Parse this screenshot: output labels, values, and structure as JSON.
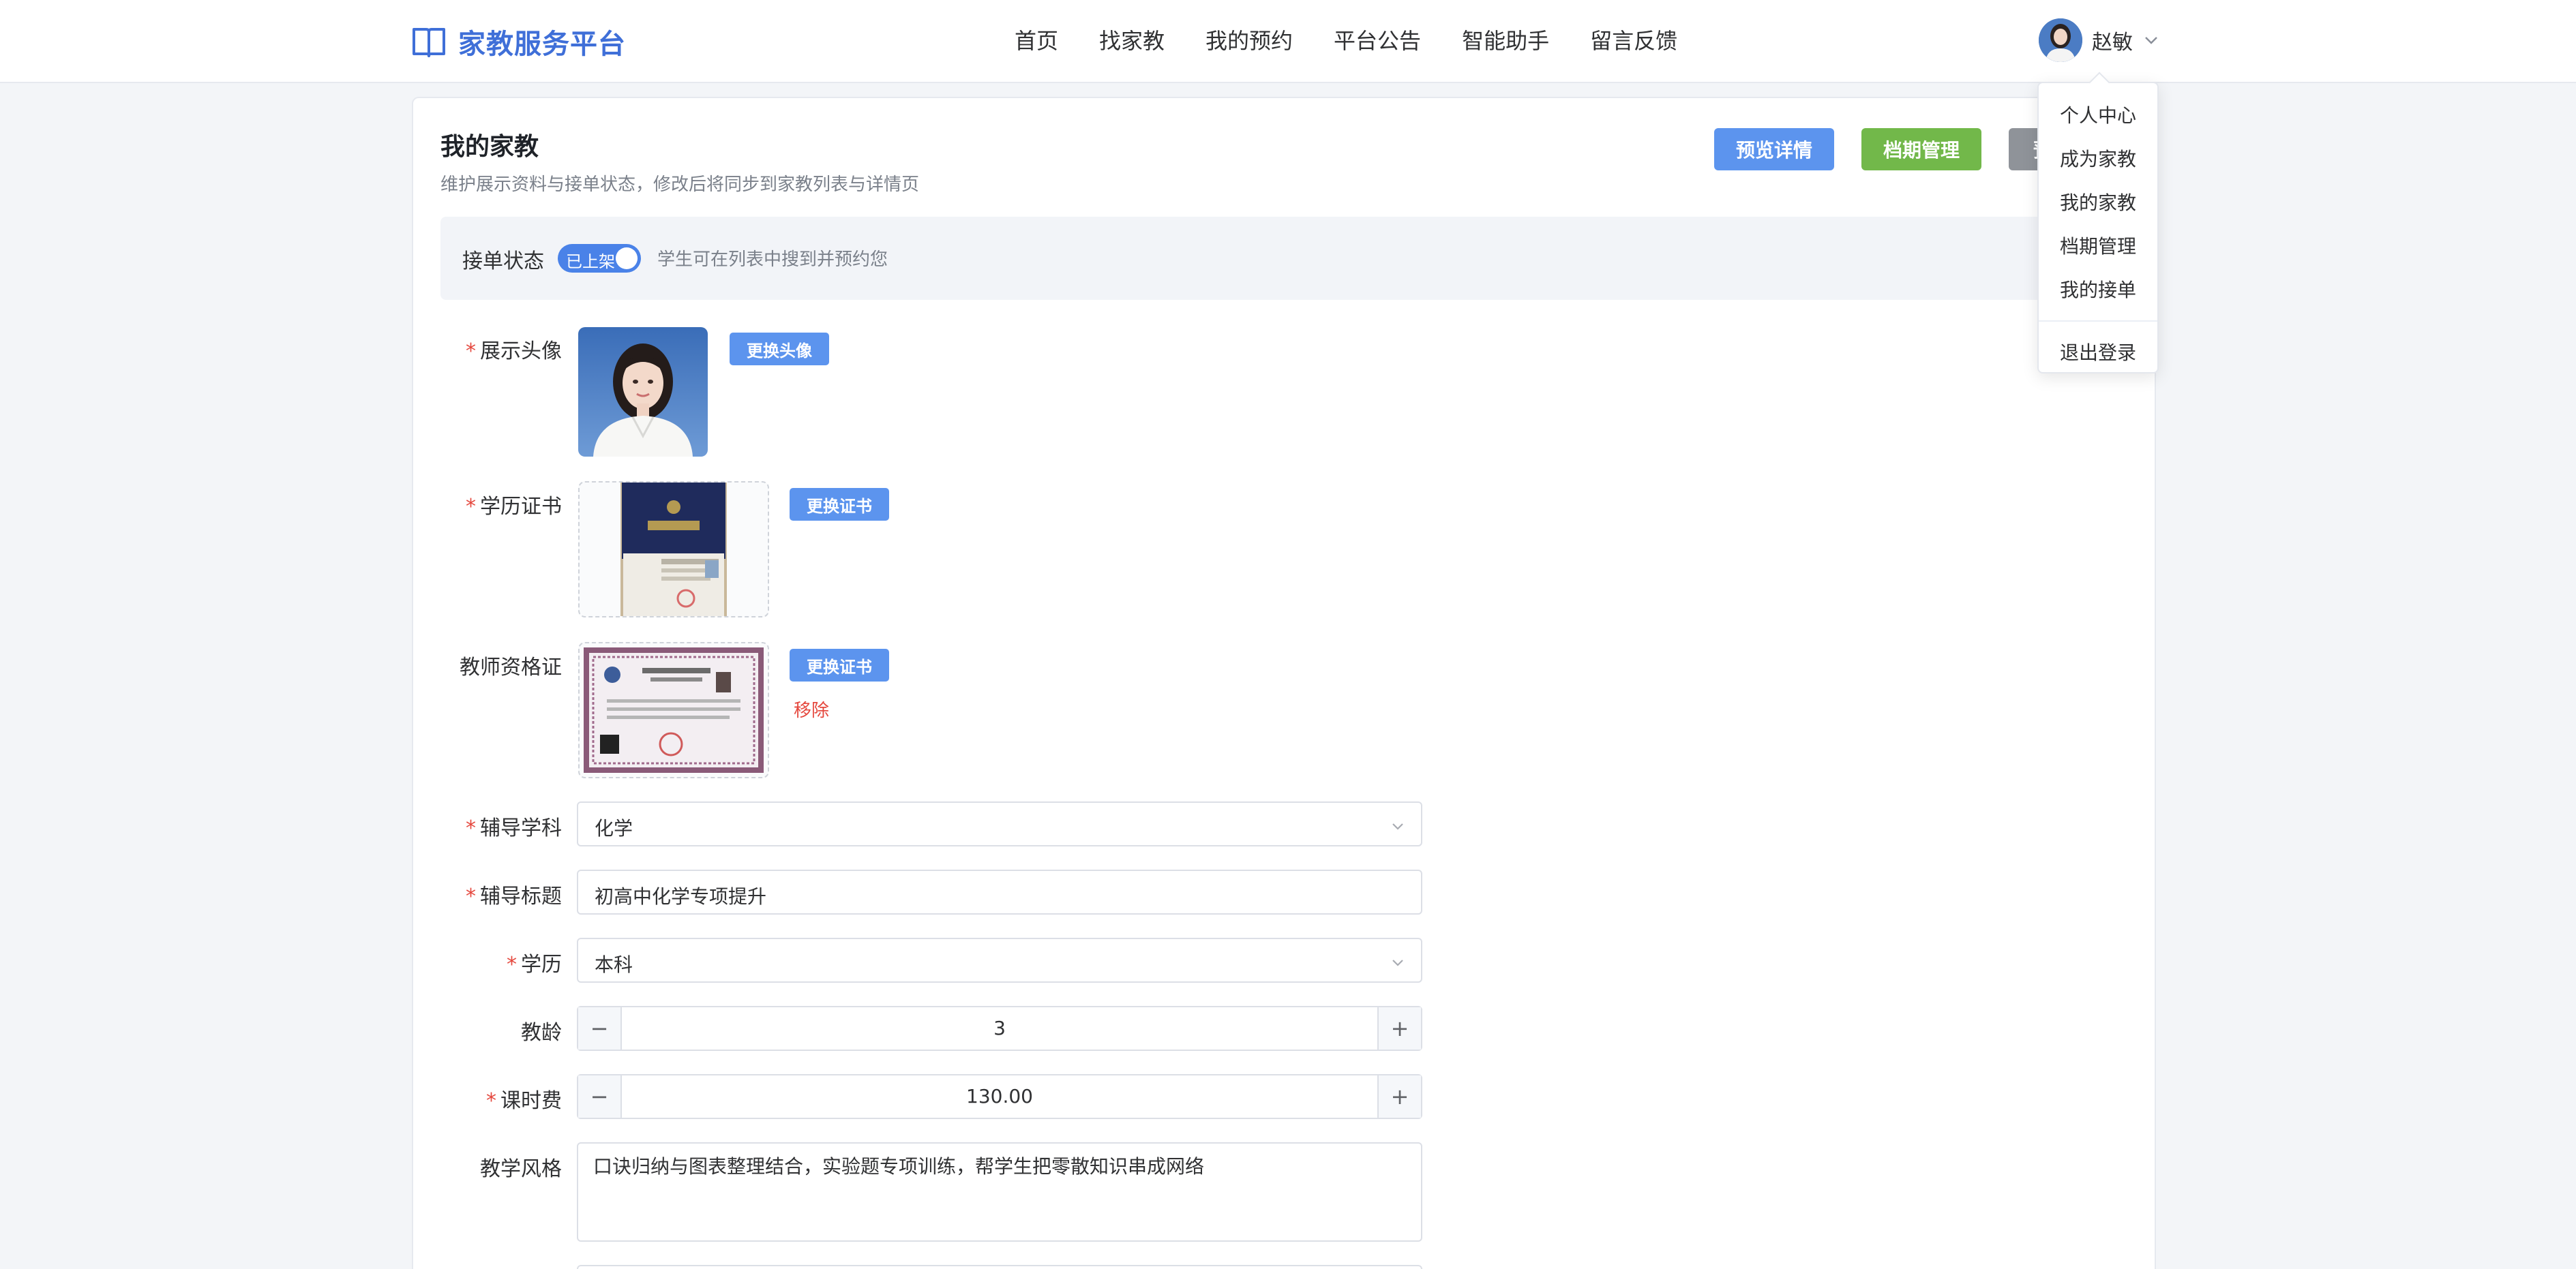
{
  "brand": {
    "name": "家教服务平台"
  },
  "nav": {
    "items": [
      "首页",
      "找家教",
      "我的预约",
      "平台公告",
      "智能助手",
      "留言反馈"
    ]
  },
  "user": {
    "name": "赵敏"
  },
  "dropdown": {
    "items": [
      "个人中心",
      "成为家教",
      "我的家教",
      "档期管理",
      "我的接单"
    ],
    "logout": "退出登录"
  },
  "page": {
    "title": "我的家教",
    "subtitle": "维护展示资料与接单状态，修改后将同步到家教列表与详情页",
    "buttons": {
      "preview": "预览详情",
      "schedule": "档期管理",
      "third": "预"
    }
  },
  "status": {
    "label": "接单状态",
    "switch_text": "已上架",
    "hint": "学生可在列表中搜到并预约您",
    "on": true
  },
  "form": {
    "avatar": {
      "label": "展示头像",
      "button": "更换头像"
    },
    "diploma": {
      "label": "学历证书",
      "button": "更换证书"
    },
    "teacher_cert": {
      "label": "教师资格证",
      "button": "更换证书",
      "remove": "移除"
    },
    "subject": {
      "label": "辅导学科",
      "value": "化学"
    },
    "heading": {
      "label": "辅导标题",
      "value": "初高中化学专项提升"
    },
    "education": {
      "label": "学历",
      "value": "本科"
    },
    "years": {
      "label": "教龄",
      "value": "3"
    },
    "fee": {
      "label": "课时费",
      "value": "130.00"
    },
    "style": {
      "label": "教学风格",
      "value": "口诀归纳与图表整理结合，实验题专项训练，帮学生把零散知识串成网络"
    }
  },
  "colors": {
    "accent": "#3f6fd8",
    "primary_button": "#5c94ee",
    "success_button": "#72b84a",
    "required": "#e5483e"
  }
}
